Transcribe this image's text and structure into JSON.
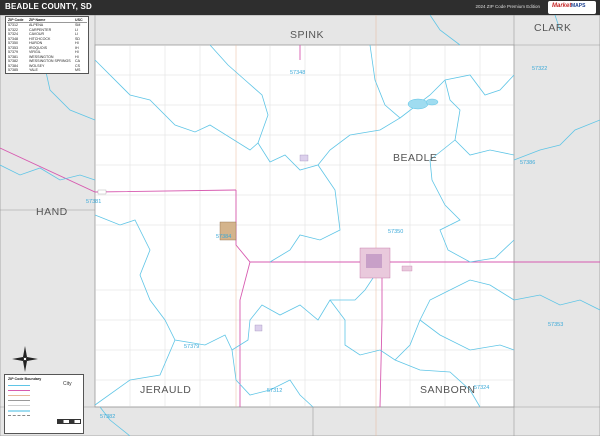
{
  "header": {
    "title": "BEADLE COUNTY, SD",
    "edition": "2024 ZIP Code Premium Edition",
    "logo_main": "Market",
    "logo_sub": "MAPS"
  },
  "colors": {
    "title_bar": "#2e2e2e",
    "zip_boundary": "#5fc5e6",
    "highway": "#d75bb0",
    "neighbor_county": "#e6e6e6",
    "zip_label": "#3aa9d8",
    "place_fill": "#c8a0c8",
    "lake": "#9fdcf0"
  },
  "legend": {
    "headers": [
      "ZIP Code",
      "ZIP Name",
      "USC"
    ],
    "rows": [
      [
        "57312",
        "ALPENA",
        "SM"
      ],
      [
        "57322",
        "CARPENTER",
        "LI"
      ],
      [
        "57324",
        "CAVOUR",
        "LI"
      ],
      [
        "57348",
        "HITCHCOCK",
        "SD"
      ],
      [
        "57350",
        "HURON",
        "HI"
      ],
      [
        "57353",
        "IROQUOIS",
        "IH"
      ],
      [
        "57379",
        "VIRGIL",
        "HI"
      ],
      [
        "57381",
        "WESSINGTON",
        "HI"
      ],
      [
        "57382",
        "WESSINGTON SPRINGS",
        "CA"
      ],
      [
        "57384",
        "WOLSEY",
        "CS"
      ],
      [
        "57385",
        "YALE",
        "MS"
      ]
    ]
  },
  "county_name": "BEADLE",
  "neighbors": {
    "north": "SPINK",
    "northeast": "CLARK",
    "west": "HAND",
    "southwest": "JERAULD",
    "south": "SANBORN"
  },
  "zip_labels": {
    "z57322": "57322",
    "z57348": "57348",
    "z57386": "57386",
    "z57381": "57381",
    "z57350": "57350",
    "z57353": "57353",
    "z57379": "57379",
    "z57312": "57312",
    "z57324": "57324",
    "z57382": "57382",
    "z57384": "57384"
  },
  "key": {
    "heading": "ZIP Code Boundary",
    "city_label": "City"
  },
  "compass_icon": "compass-rose-icon"
}
